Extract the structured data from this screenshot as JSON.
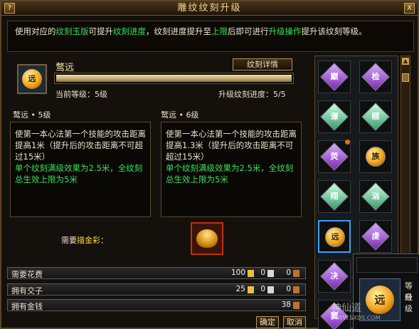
{
  "window": {
    "title": "雕纹纹刻升级",
    "help_label": "?",
    "close_label": "X"
  },
  "description": {
    "part1": "使用对应的",
    "hl1": "纹刻玉版",
    "part2": "可提升",
    "hl2": "纹刻进度",
    "part3": "，纹刻进度提升至",
    "hl3": "上限",
    "part4": "后即可进行",
    "hl4": "升级操作",
    "part5": "提升该纹刻等级。"
  },
  "item": {
    "icon_glyph": "远",
    "name": "鹜远",
    "detail_button": "纹刻详情",
    "progress_fraction": 1.0,
    "current_level": "当前等级：5级",
    "upgrade_progress": "升级纹刻进度：5/5"
  },
  "current": {
    "title": "鹜远 • 5级",
    "effect": "使第一本心法第一个技能的攻击距离提高1米（提升后的攻击距离不可超过15米）",
    "bonus": "单个纹刻满级效果为2.5米，全纹刻总生效上限为5米"
  },
  "next": {
    "title": "鹜远 • 6级",
    "effect": "使第一本心法第一个技能的攻击距离提高1.3米（提升后的攻击距离不可超过15米）",
    "bonus": "单个纹刻满级效果为2.5米，全纹刻总生效上限为5米"
  },
  "material": {
    "prefix": "需要",
    "name": "描金彩",
    "suffix": "："
  },
  "costs": [
    {
      "label": "需要花费",
      "gold": "100",
      "silver": "0",
      "copper": "0"
    },
    {
      "label": "拥有交子",
      "gold": "25",
      "silver": "0",
      "copper": "0"
    },
    {
      "label": "拥有金钱",
      "copper_only": "38"
    }
  ],
  "buttons": {
    "confirm": "确定",
    "cancel": "取消"
  },
  "runes": [
    {
      "glyph": "巅",
      "style": "purple"
    },
    {
      "glyph": "检",
      "style": "purple"
    },
    {
      "glyph": "谭",
      "style": "green"
    },
    {
      "glyph": "颐",
      "style": "green"
    },
    {
      "glyph": "荧",
      "style": "purple"
    },
    {
      "glyph": "族",
      "style": "orb"
    },
    {
      "glyph": "翔",
      "style": "green"
    },
    {
      "glyph": "汹",
      "style": "green"
    },
    {
      "glyph": "远",
      "style": "orb"
    },
    {
      "glyph": "虔",
      "style": "purple"
    },
    {
      "glyph": "决",
      "style": "purple"
    },
    {
      "glyph": "",
      "style": "orb"
    },
    {
      "glyph": "窦",
      "style": "purple"
    }
  ],
  "tooltip": {
    "line1": "等级",
    "line2": "升级",
    "icon_glyph": "远"
  },
  "watermark": {
    "text": "神仙道",
    "url": "WWW.SXDS.COM"
  },
  "colors": {
    "accent_green": "#33e05a",
    "gold_text": "#f4d98a",
    "material_yellow": "#ffd940"
  }
}
